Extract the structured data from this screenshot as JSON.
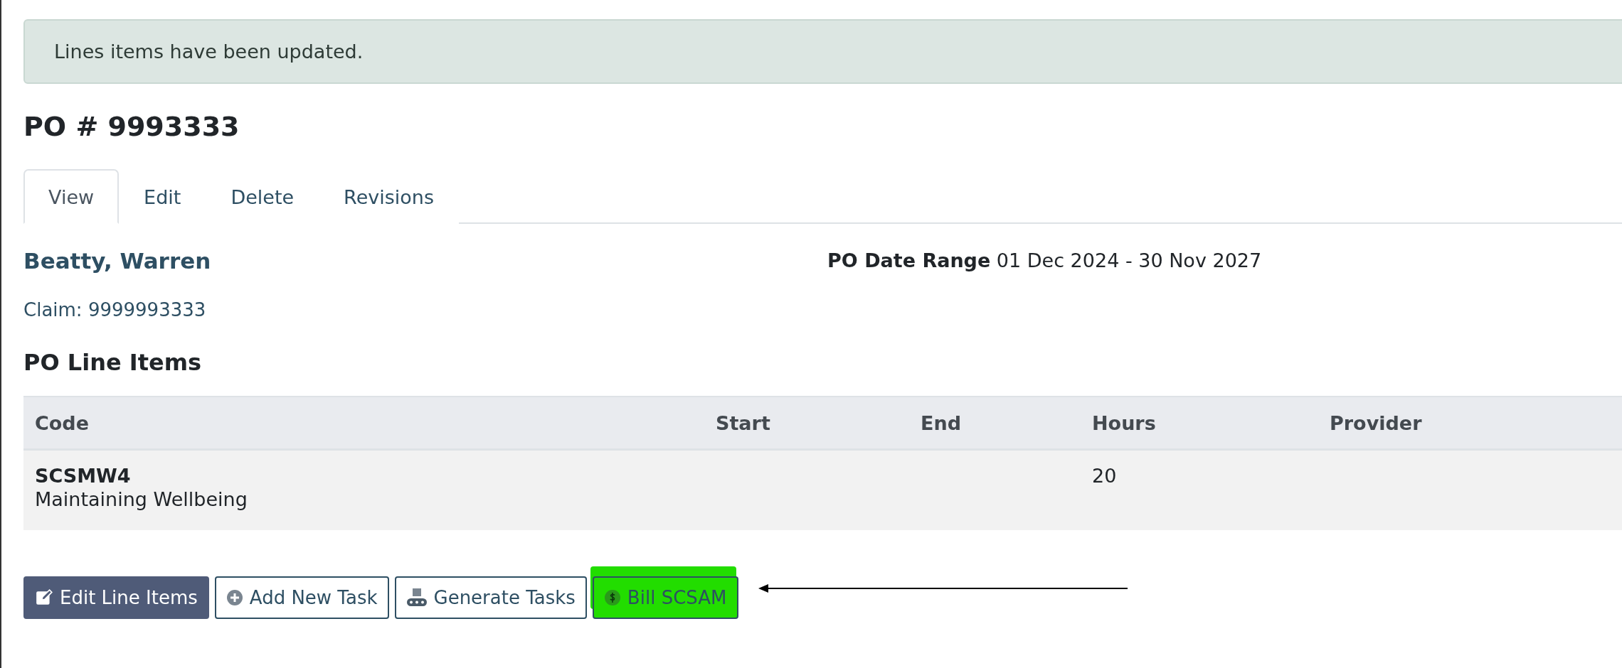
{
  "alert": {
    "message": "Lines items have been updated."
  },
  "title": "PO # 9993333",
  "tabs": [
    {
      "label": "View",
      "selected": true
    },
    {
      "label": "Edit",
      "selected": false
    },
    {
      "label": "Delete",
      "selected": false
    },
    {
      "label": "Revisions",
      "selected": false
    }
  ],
  "client": {
    "name": "Beatty, Warren",
    "claim": "Claim: 9999993333"
  },
  "date_range": "**PO Date Range** 01 Dec 2024 - 30 Nov 2027",
  "section_title": "PO Line Items",
  "table": {
    "columns": [
      "Code",
      "Start",
      "End",
      "Hours",
      "Provider"
    ],
    "rows": [
      {
        "code": "SCSMW4",
        "description": "Maintaining Wellbeing",
        "start": "",
        "end": "",
        "hours": "20",
        "provider": ""
      }
    ]
  },
  "buttons": [
    {
      "label": "Edit Line Items",
      "kind": "primary",
      "highlighted": false
    },
    {
      "label": "Add New Task",
      "kind": "outline",
      "highlighted": false
    },
    {
      "label": "Generate Tasks",
      "kind": "outline",
      "highlighted": false
    },
    {
      "label": "Bill SCSAM",
      "kind": "outline",
      "highlighted": true
    }
  ]
}
